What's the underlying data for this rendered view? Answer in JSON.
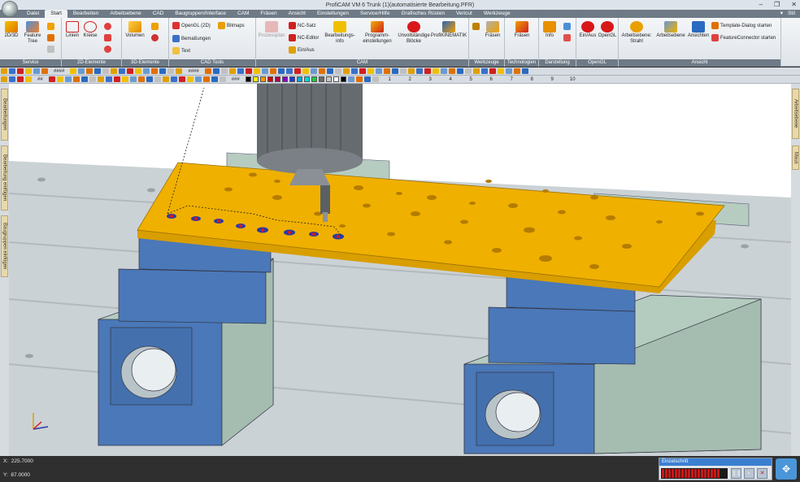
{
  "window": {
    "title": "ProfiCAM VM 6 Trunk  (1)(automatisierte Bearbeitung.PFR)",
    "minimize": "–",
    "maximize": "❐",
    "close": "✕"
  },
  "menu": {
    "tabs": [
      "Datei",
      "Start",
      "Bearbeiten",
      "Arbeitsebene",
      "CAD",
      "Baugruppen/Interface",
      "CAM",
      "Fräsen",
      "Ansicht",
      "Einstellungen",
      "Service/Hilfe",
      "Grafisches Rüsten",
      "Vericut",
      "Werkzeuge"
    ],
    "active": "Start",
    "help": "▾",
    "style": "Stil"
  },
  "ribbon": {
    "groups": {
      "service": "Service",
      "elements2d": "2D-Elemente",
      "elements3d": "3D-Elemente",
      "cadtools": "CAD Tools",
      "cam": "CAM",
      "werkzeuge": "Werkzeuge",
      "technologien": "Technologien",
      "darstellung": "Darstellung",
      "opengl": "OpenGL",
      "ansicht": "Ansicht"
    },
    "buttons": {
      "b2d3d": "2D/3D",
      "feature_tree": "Feature Tree",
      "linien": "Linien",
      "kreise": "Kreise",
      "volumen": "Volumen",
      "opengl2d": "OpenGL (2D)",
      "bitmaps": "Bitmaps",
      "bemassungen": "Bemaßungen",
      "text": "Text",
      "prozessplan": "Prozessplan",
      "ncsatz": "NC-Satz",
      "nceditor": "NC-Editor",
      "einaus": "Ein/Aus",
      "bearbeitungsinfo": "Bearbeitungs-info",
      "programmeinstellungen": "Programm-einstellungen",
      "unvollstaendige": "Unvollständige Blöcke",
      "profikinematik": "ProfiKINEMATIK",
      "fraesen1": "Fräsen",
      "fraesen2": "Fräsen",
      "info": "Info",
      "einausgl": "Ein/Aus",
      "opengl": "OpenGL",
      "arbeitsebene_strahl": "Arbeitsebene: Strahl",
      "arbeitsebene": "Arbeitsebene",
      "ansichten": "Ansichten",
      "template_dialog": "Template-Dialog starten",
      "featureconnector": "FeatureConnector starten"
    }
  },
  "toolbar": {
    "fields": [
      "####",
      "####",
      "##"
    ],
    "color_label": "###",
    "swatches": [
      "#000000",
      "#ffff00",
      "#ff9900",
      "#d40000",
      "#b0004a",
      "#8a00c8",
      "#2038d8",
      "#00a8d8",
      "#00d8d8",
      "#20c840",
      "#6a6a6a",
      "#c8c8c8",
      "#ffffff",
      "#000000"
    ],
    "numbers": [
      "1",
      "2",
      "3",
      "4",
      "5",
      "6",
      "7",
      "8",
      "9",
      "10"
    ]
  },
  "sidetabs": {
    "left": [
      "Bearbeitungen",
      "Bearbeitung einfügen",
      "Baugruppen einfügen"
    ],
    "right": [
      "Arbeitsebene",
      "Maus"
    ]
  },
  "status": {
    "x_label": "X:",
    "x_value": "225.7000",
    "y_label": "Y:",
    "y_value": "87.0000",
    "panel_title": "Einzelschritt",
    "led_count": 18
  },
  "colors": {
    "plate": "#f0b000",
    "vise_blue": "#4a78b8",
    "vise_green": "#b8d0c0",
    "table": "#c9d0d3"
  }
}
